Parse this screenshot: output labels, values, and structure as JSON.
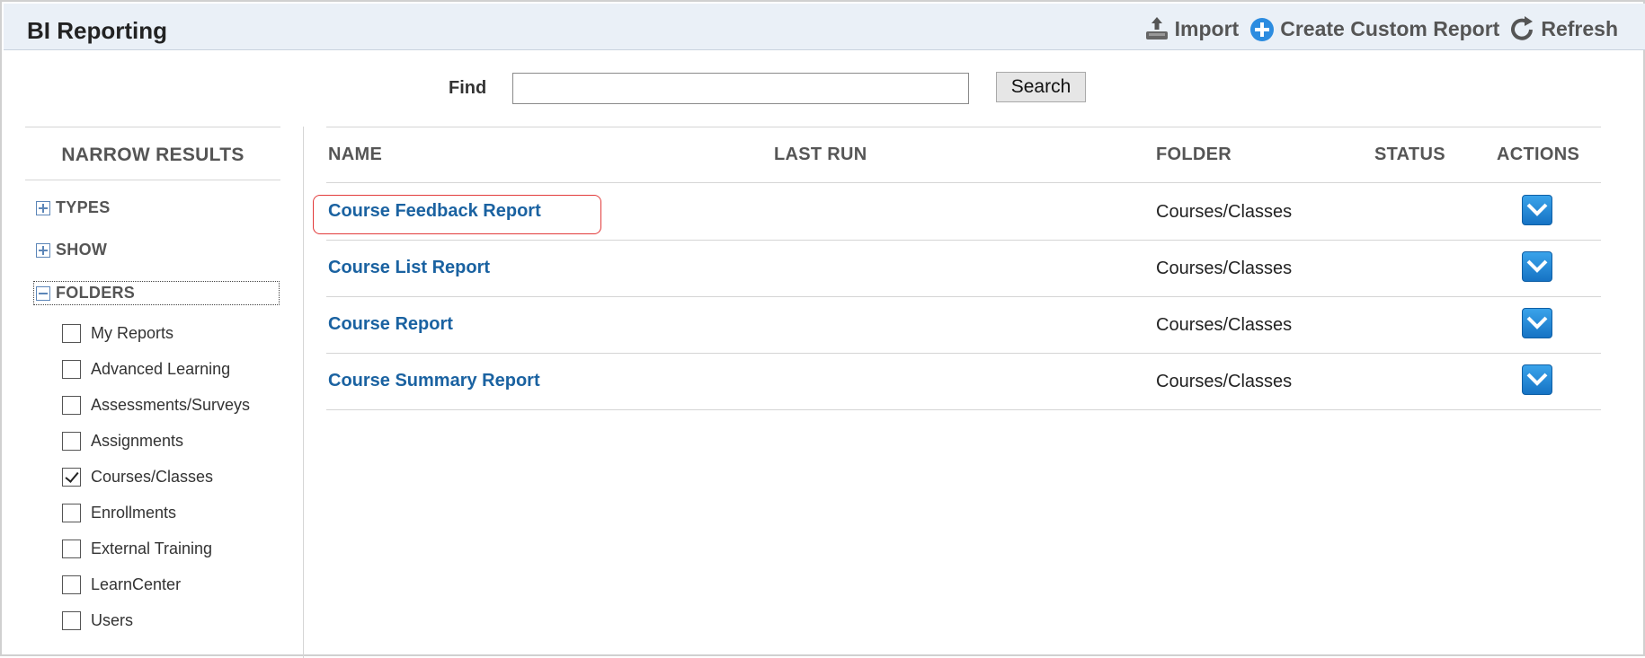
{
  "header": {
    "title": "BI Reporting",
    "toolbar": [
      {
        "label": "Import",
        "icon": "import-icon"
      },
      {
        "label": "Create Custom Report",
        "icon": "add-circle-icon"
      },
      {
        "label": "Refresh",
        "icon": "refresh-icon"
      }
    ]
  },
  "search": {
    "label": "Find",
    "value": "",
    "placeholder": "",
    "button_label": "Search"
  },
  "sidebar": {
    "title": "NARROW RESULTS",
    "sections": [
      {
        "label": "TYPES",
        "expanded": false
      },
      {
        "label": "SHOW",
        "expanded": false
      },
      {
        "label": "FOLDERS",
        "expanded": true
      }
    ],
    "folders": [
      {
        "label": "My Reports",
        "checked": false
      },
      {
        "label": "Advanced Learning",
        "checked": false
      },
      {
        "label": "Assessments/Surveys",
        "checked": false
      },
      {
        "label": "Assignments",
        "checked": false
      },
      {
        "label": "Courses/Classes",
        "checked": true
      },
      {
        "label": "Enrollments",
        "checked": false
      },
      {
        "label": "External Training",
        "checked": false
      },
      {
        "label": "LearnCenter",
        "checked": false
      },
      {
        "label": "Users",
        "checked": false
      }
    ]
  },
  "table": {
    "columns": {
      "name": "NAME",
      "last_run": "LAST RUN",
      "folder": "FOLDER",
      "status": "STATUS",
      "actions": "ACTIONS"
    },
    "rows": [
      {
        "name": "Course Feedback Report",
        "last_run": "",
        "folder": "Courses/Classes",
        "status": "",
        "highlighted": true
      },
      {
        "name": "Course List Report",
        "last_run": "",
        "folder": "Courses/Classes",
        "status": ""
      },
      {
        "name": "Course Report",
        "last_run": "",
        "folder": "Courses/Classes",
        "status": ""
      },
      {
        "name": "Course Summary Report",
        "last_run": "",
        "folder": "Courses/Classes",
        "status": ""
      }
    ]
  },
  "colors": {
    "header_bg": "#eaf0f7",
    "link": "#1a62a1",
    "action_button": "#1e86d6",
    "highlight_outline": "#e23b3b"
  }
}
